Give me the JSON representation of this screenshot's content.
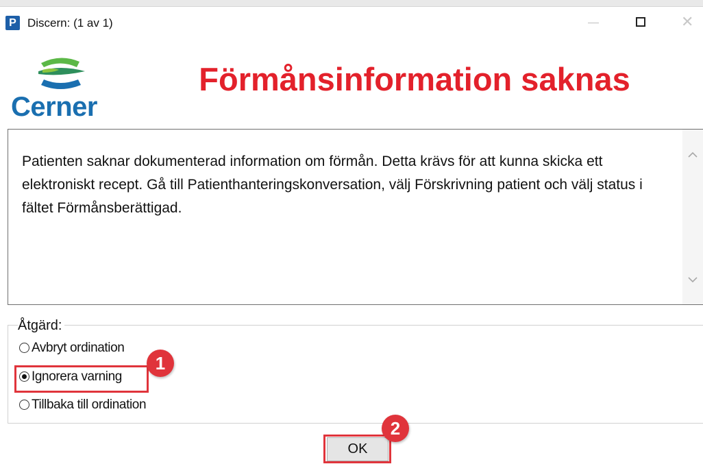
{
  "window": {
    "app_icon_letter": "P",
    "title": "Discern:  (1 av 1)",
    "minimize_icon": "minimize-icon",
    "maximize_icon": "maximize-icon",
    "close_icon": "close-icon"
  },
  "header": {
    "logo_text": "Cerner",
    "alert_title": "Förmånsinformation saknas",
    "title_color": "#e3212b"
  },
  "message": {
    "text": "Patienten saknar dokumenterad information om förmån. Detta krävs för att kunna skicka ett elektroniskt recept. Gå till Patienthanteringskonversation, välj Förskrivning patient och välj status i fältet Förmånsberättigad."
  },
  "actions": {
    "label": "Åtgärd:",
    "options": [
      {
        "label": "Avbryt ordination",
        "checked": false
      },
      {
        "label": "Ignorera varning",
        "checked": true
      },
      {
        "label": "Tillbaka till ordination",
        "checked": false
      }
    ]
  },
  "ok_button": {
    "label": "OK"
  },
  "annotations": {
    "badge_1": "1",
    "badge_2": "2",
    "highlight_color": "#e0343b"
  }
}
